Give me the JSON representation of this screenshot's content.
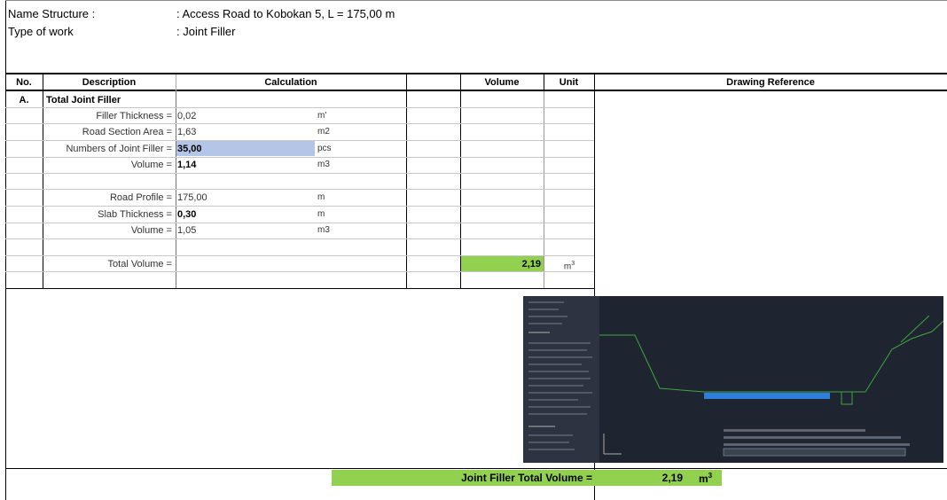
{
  "header": {
    "name_label": "Name Structure :",
    "name_value": ": Access Road to Kobokan 5, L = 175,00 m",
    "type_label": "Type of work",
    "type_value": ": Joint Filler"
  },
  "columns": {
    "no": "No.",
    "description": "Description",
    "calculation": "Calculation",
    "volume": "Volume",
    "unit": "Unit",
    "drawing": "Drawing Reference"
  },
  "section": {
    "no": "A.",
    "title": "Total Joint Filler"
  },
  "rows": [
    {
      "label": "Filler Thickness =",
      "value": "0,02",
      "unit": "m'"
    },
    {
      "label": "Road Section Area =",
      "value": "1,63",
      "unit": "m2"
    },
    {
      "label": "Numbers of Joint Filler =",
      "value": "35,00",
      "unit": "pcs"
    },
    {
      "label": "Volume =",
      "value": "1,14",
      "unit": "m3"
    },
    {
      "label": "Road Profile =",
      "value": "175,00",
      "unit": "m"
    },
    {
      "label": "Slab Thickness =",
      "value": "0,30",
      "unit": "m"
    },
    {
      "label": "Volume =",
      "value": "1,05",
      "unit": "m3"
    }
  ],
  "total": {
    "label": "Total Volume =",
    "value": "2,19",
    "unit": "m",
    "unit_sup": "3"
  },
  "footer": {
    "label": "Joint Filler Total Volume =",
    "value": "2,19",
    "unit": "m",
    "unit_sup": "3"
  },
  "colors": {
    "highlight_blue": "#b4c6e7",
    "highlight_green": "#92d050"
  }
}
